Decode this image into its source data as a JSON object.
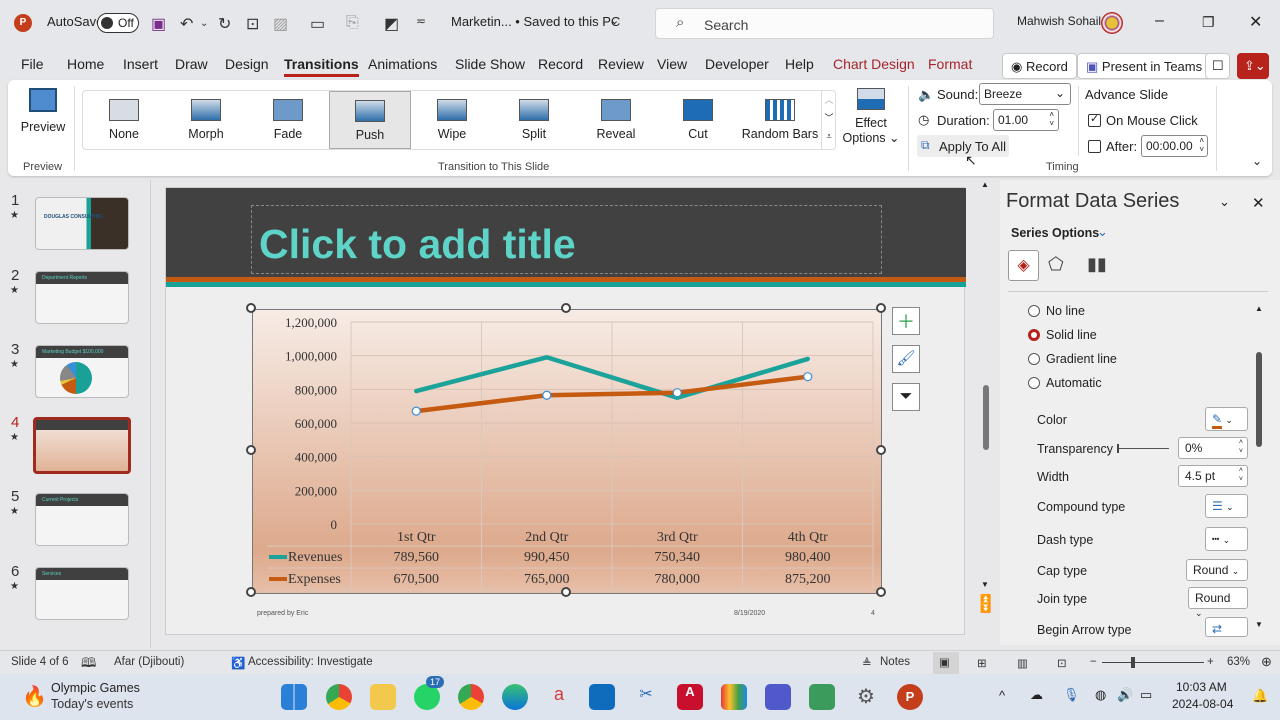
{
  "titlebar": {
    "autosave_label": "AutoSave",
    "autosave_state": "Off",
    "doc_title": "Marketin... • Saved to this PC",
    "search_placeholder": "Search",
    "user_name": "Mahwish Sohail"
  },
  "tabs": [
    "File",
    "Home",
    "Insert",
    "Draw",
    "Design",
    "Transitions",
    "Animations",
    "Slide Show",
    "Record",
    "Review",
    "View",
    "Developer",
    "Help",
    "Chart Design",
    "Format"
  ],
  "active_tab": "Transitions",
  "tab_buttons": {
    "record": "Record",
    "present_teams": "Present in Teams"
  },
  "ribbon": {
    "preview_button": "Preview",
    "preview_group": "Preview",
    "transitions": [
      "None",
      "Morph",
      "Fade",
      "Push",
      "Wipe",
      "Split",
      "Reveal",
      "Cut",
      "Random Bars"
    ],
    "selected_transition": "Push",
    "transition_group": "Transition to This Slide",
    "effect_options": [
      "Effect",
      "Options"
    ],
    "sound_label": "Sound:",
    "sound_value": "Breeze",
    "duration_label": "Duration:",
    "duration_value": "01.00",
    "apply_all": "Apply To All",
    "advance_title": "Advance Slide",
    "on_mouse_click": "On Mouse Click",
    "on_mouse_click_checked": true,
    "after_label": "After:",
    "after_value": "00:00.00",
    "after_checked": false,
    "timing_group": "Timing"
  },
  "thumbnails": [
    {
      "num": "1",
      "title": "DOUGLAS CONSULTING"
    },
    {
      "num": "2",
      "title": "Department Reports"
    },
    {
      "num": "3",
      "title": "Marketing Budget $100,000"
    },
    {
      "num": "4",
      "title": ""
    },
    {
      "num": "5",
      "title": "Current Projects"
    },
    {
      "num": "6",
      "title": "Services"
    }
  ],
  "current_slide": 4,
  "slide": {
    "title_placeholder": "Click to add title",
    "footer_left": "prepared by Eric",
    "footer_date": "8/19/2020",
    "footer_page": "4"
  },
  "chart_data": {
    "type": "line",
    "categories": [
      "1st Qtr",
      "2nd Qtr",
      "3rd Qtr",
      "4th Qtr"
    ],
    "series": [
      {
        "name": "Revenues",
        "values": [
          789560,
          990450,
          750340,
          980400
        ],
        "color": "#1ba39a"
      },
      {
        "name": "Expenses",
        "values": [
          670500,
          765000,
          780000,
          875200
        ],
        "color": "#c55a11"
      }
    ],
    "y_ticks": [
      "1,200,000",
      "1,000,000",
      "800,000",
      "600,000",
      "400,000",
      "200,000",
      "0"
    ],
    "ylim": [
      0,
      1200000
    ],
    "data_table": [
      [
        "789,560",
        "990,450",
        "750,340",
        "980,400"
      ],
      [
        "670,500",
        "765,000",
        "780,000",
        "875,200"
      ]
    ],
    "grid": true,
    "legend": "data-table",
    "selected_series": "Expenses"
  },
  "pane": {
    "title": "Format Data Series",
    "section": "Series Options",
    "line_options": [
      "No line",
      "Solid line",
      "Gradient line",
      "Automatic"
    ],
    "selected_line": "Solid line",
    "color_label": "Color",
    "transparency_label": "Transparency",
    "transparency_value": "0%",
    "width_label": "Width",
    "width_value": "4.5 pt",
    "compound_label": "Compound type",
    "dash_label": "Dash type",
    "cap_label": "Cap type",
    "cap_value": "Round",
    "join_label": "Join type",
    "join_value": "Round",
    "begin_arrow_label": "Begin Arrow type",
    "line_color": "#c55a11"
  },
  "status": {
    "slide_of": "Slide 4 of 6",
    "language": "Afar (Djibouti)",
    "accessibility": "Accessibility: Investigate",
    "notes": "Notes",
    "zoom": "63%"
  },
  "taskbar": {
    "widget_title": "Olympic Games",
    "widget_sub": "Today's events",
    "whatsapp_badge": "17",
    "time": "10:03 AM",
    "date": "2024-08-04"
  }
}
